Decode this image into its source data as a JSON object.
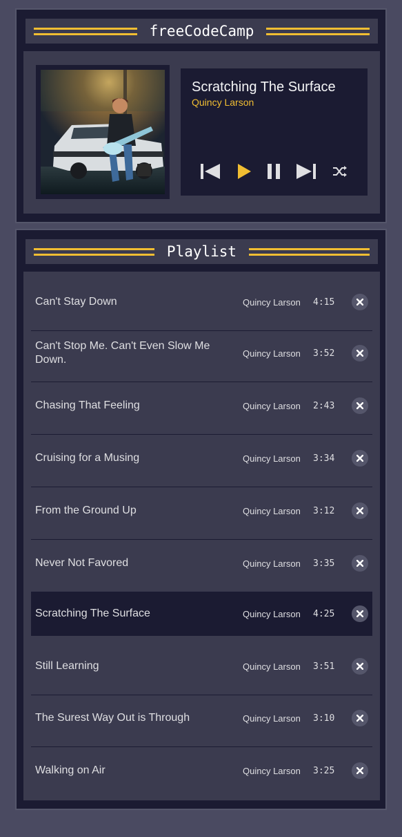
{
  "colors": {
    "background": "#4a4a61",
    "panel": "#1b1b32",
    "panel_inner": "#3b3b4f",
    "accent": "#f1be32"
  },
  "player": {
    "title": "freeCodeCamp",
    "now_playing": {
      "title": "Scratching The Surface",
      "artist": "Quincy Larson"
    },
    "controls": [
      {
        "name": "previous-button",
        "icon": "previous-track-icon"
      },
      {
        "name": "play-button",
        "icon": "play-icon"
      },
      {
        "name": "pause-button",
        "icon": "pause-icon"
      },
      {
        "name": "next-button",
        "icon": "next-track-icon"
      },
      {
        "name": "shuffle-button",
        "icon": "shuffle-icon"
      }
    ]
  },
  "playlist": {
    "title": "Playlist",
    "active_index": 6,
    "songs": [
      {
        "title": "Can't Stay Down",
        "artist": "Quincy Larson",
        "duration": "4:15"
      },
      {
        "title": "Can't Stop Me. Can't Even Slow Me Down.",
        "artist": "Quincy Larson",
        "duration": "3:52"
      },
      {
        "title": "Chasing That Feeling",
        "artist": "Quincy Larson",
        "duration": "2:43"
      },
      {
        "title": "Cruising for a Musing",
        "artist": "Quincy Larson",
        "duration": "3:34"
      },
      {
        "title": "From the Ground Up",
        "artist": "Quincy Larson",
        "duration": "3:12"
      },
      {
        "title": "Never Not Favored",
        "artist": "Quincy Larson",
        "duration": "3:35"
      },
      {
        "title": "Scratching The Surface",
        "artist": "Quincy Larson",
        "duration": "4:25"
      },
      {
        "title": "Still Learning",
        "artist": "Quincy Larson",
        "duration": "3:51"
      },
      {
        "title": "The Surest Way Out is Through",
        "artist": "Quincy Larson",
        "duration": "3:10"
      },
      {
        "title": "Walking on Air",
        "artist": "Quincy Larson",
        "duration": "3:25"
      }
    ]
  }
}
